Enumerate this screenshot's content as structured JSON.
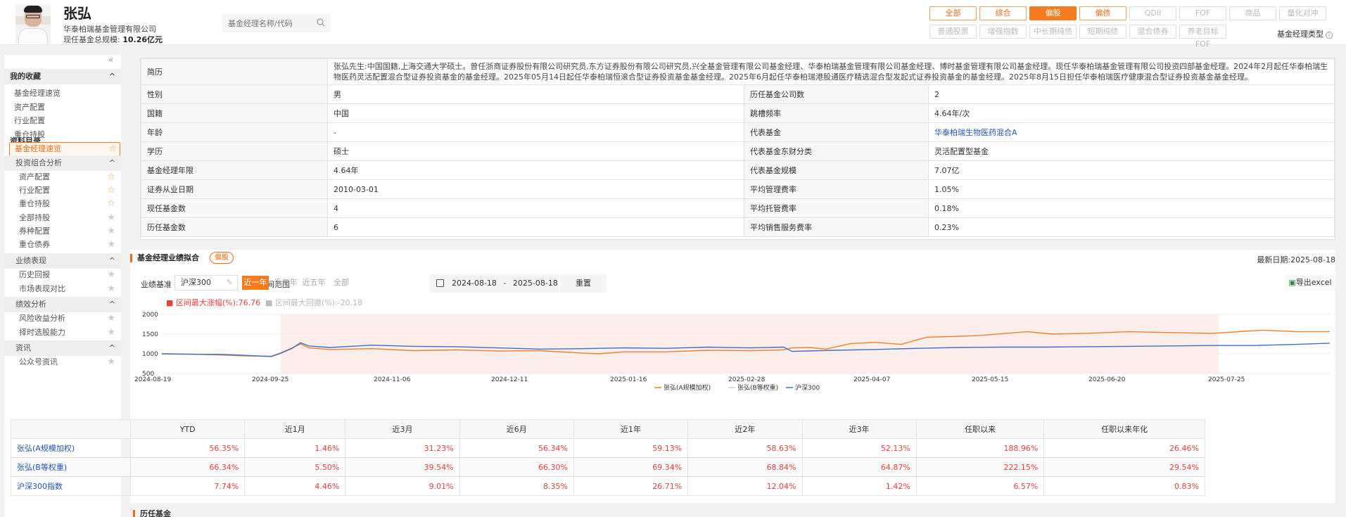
{
  "header": {
    "name": "张弘",
    "company": "华泰柏瑞基金管理有限公司",
    "scale_label": "现任基金总规模:",
    "scale_value": "10.26亿元",
    "search_placeholder": "基金经理名称/代码",
    "type_label": "基金经理类型",
    "type_buttons_row1": [
      "全部",
      "综合",
      "偏股",
      "偏债",
      "QDII",
      "FOF",
      "商品",
      "量化对冲"
    ],
    "type_buttons_row2": [
      "普通股票",
      "增强指数",
      "中长期纯债",
      "短期纯债",
      "混合债券",
      "养老目标FOF"
    ],
    "active_type": "偏股"
  },
  "sidebar": {
    "favorites_title": "我的收藏",
    "favorites": [
      "基金经理速览",
      "资产配置",
      "行业配置",
      "重仓持股"
    ],
    "catalog_title": "资料目录",
    "selected_item": "基金经理速览",
    "portfolio_title": "投资组合分析",
    "portfolio_items": [
      {
        "label": "资产配置",
        "starred": true
      },
      {
        "label": "行业配置",
        "starred": true
      },
      {
        "label": "重仓持股",
        "starred": true
      },
      {
        "label": "全部持股",
        "starred": false
      },
      {
        "label": "券种配置",
        "starred": false
      },
      {
        "label": "重仓债券",
        "starred": false
      }
    ],
    "performance_title": "业绩表现",
    "performance_items": [
      "历史回报",
      "市场表现对比"
    ],
    "attribution_title": "绩效分析",
    "attribution_items": [
      "风险收益分析",
      "择时选股能力"
    ],
    "news_title": "资讯",
    "news_items": [
      "公众号资讯"
    ]
  },
  "profile": {
    "bio_label": "简历",
    "bio": "张弘先生:中国国籍,上海交通大学硕士。曾任浙商证券股份有限公司研究员,东方证券股份有限公司研究员,兴全基金管理有限公司基金经理、华泰柏瑞基金管理有限公司基金经理、博时基金管理有限公司基金经理。现任华泰柏瑞基金管理有限公司投资四部基金经理。2024年2月起任华泰柏瑞生物医药灵活配置混合型证券投资基金的基金经理。2025年05月14日起任华泰柏瑞恒滚合型证券投资基金基金经理。2025年6月起任华泰柏瑞港股通医疗精选混合型发起式证券投资基金的基金经理。2025年8月15日担任华泰柏瑞医疗健康混合型证券投资基金基金经理。",
    "rows": [
      {
        "l1": "性别",
        "v1": "男",
        "l2": "历任基金公司数",
        "v2": "2"
      },
      {
        "l1": "国籍",
        "v1": "中国",
        "l2": "跳槽频率",
        "v2": "4.64年/次"
      },
      {
        "l1": "年龄",
        "v1": "-",
        "l2": "代表基金",
        "v2": "华泰柏瑞生物医药混合A"
      },
      {
        "l1": "学历",
        "v1": "硕士",
        "l2": "代表基金东财分类",
        "v2": "灵活配置型基金"
      },
      {
        "l1": "基金经理年限",
        "v1": "4.64年",
        "l2": "代表基金规模",
        "v2": "7.07亿"
      },
      {
        "l1": "证券从业日期",
        "v1": "2010-03-01",
        "l2": "平均管理费率",
        "v2": "1.05%"
      },
      {
        "l1": "现任基金数",
        "v1": "4",
        "l2": "平均托管费率",
        "v2": "0.18%"
      },
      {
        "l1": "历任基金数",
        "v1": "6",
        "l2": "平均销售服务费率",
        "v2": "0.23%"
      }
    ]
  },
  "performance": {
    "title": "基金经理业绩拟合",
    "tag": "偏股",
    "latest_date": "最新日期:2025-08-18",
    "bench_label": "业绩基准",
    "bench_value": "沪深300",
    "range_label": "时间范围",
    "ranges": [
      "近一年",
      "近三年",
      "近五年",
      "全部"
    ],
    "active_range": "近一年",
    "date_start": "2024-08-18",
    "date_sep": "-",
    "date_end": "2025-08-18",
    "reset": "重置",
    "export": "导出excel",
    "stat_max_rise": "■ 区间最大涨幅(%):76.76",
    "stat_max_drawdown": "■ 区间最大回撤(%):-20.18"
  },
  "chart_data": {
    "type": "line",
    "y_ticks": [
      "2000",
      "1500",
      "1000",
      "500"
    ],
    "ylim": [
      500,
      2000
    ],
    "x_ticks": [
      "2024-08-19",
      "2024-09-25",
      "2024-11-06",
      "2024-12-11",
      "2025-01-16",
      "2025-02-28",
      "2025-04-07",
      "2025-05-15",
      "2025-06-20",
      "2025-07-25"
    ],
    "highlight_range": [
      "2024-09-24",
      "2025-08-01"
    ],
    "series": [
      {
        "name": "张弘(A规模加权)",
        "color": "#f07f2a",
        "points": [
          [
            0,
            1000
          ],
          [
            0.03,
            995
          ],
          [
            0.07,
            970
          ],
          [
            0.1,
            945
          ],
          [
            0.13,
            940
          ],
          [
            0.14,
            1010
          ],
          [
            0.155,
            1150
          ],
          [
            0.165,
            1250
          ],
          [
            0.175,
            1150
          ],
          [
            0.2,
            1110
          ],
          [
            0.25,
            1130
          ],
          [
            0.3,
            1080
          ],
          [
            0.35,
            1100
          ],
          [
            0.4,
            1070
          ],
          [
            0.45,
            1080
          ],
          [
            0.5,
            1020
          ],
          [
            0.52,
            1000
          ],
          [
            0.55,
            1050
          ],
          [
            0.6,
            1050
          ],
          [
            0.65,
            1090
          ],
          [
            0.7,
            1080
          ],
          [
            0.74,
            1100
          ],
          [
            0.75,
            1150
          ],
          [
            0.77,
            1160
          ],
          [
            0.79,
            1120
          ],
          [
            0.82,
            1260
          ],
          [
            0.85,
            1290
          ],
          [
            0.88,
            1240
          ],
          [
            0.91,
            1420
          ],
          [
            0.94,
            1440
          ],
          [
            0.97,
            1460
          ],
          [
            1,
            1510
          ],
          [
            1.03,
            1560
          ],
          [
            1.06,
            1500
          ],
          [
            1.1,
            1520
          ],
          [
            1.15,
            1560
          ],
          [
            1.2,
            1540
          ],
          [
            1.25,
            1520
          ],
          [
            1.31,
            1600
          ],
          [
            1.35,
            1560
          ],
          [
            1.39,
            1560
          ]
        ]
      },
      {
        "name": "沪深300",
        "color": "#3d6fd1",
        "points": [
          [
            0,
            1000
          ],
          [
            0.03,
            990
          ],
          [
            0.07,
            985
          ],
          [
            0.1,
            960
          ],
          [
            0.13,
            930
          ],
          [
            0.14,
            1000
          ],
          [
            0.155,
            1140
          ],
          [
            0.165,
            1280
          ],
          [
            0.175,
            1200
          ],
          [
            0.2,
            1160
          ],
          [
            0.25,
            1220
          ],
          [
            0.3,
            1190
          ],
          [
            0.35,
            1180
          ],
          [
            0.4,
            1150
          ],
          [
            0.45,
            1120
          ],
          [
            0.5,
            1130
          ],
          [
            0.55,
            1150
          ],
          [
            0.6,
            1140
          ],
          [
            0.65,
            1170
          ],
          [
            0.7,
            1150
          ],
          [
            0.74,
            1170
          ],
          [
            0.75,
            1060
          ],
          [
            0.8,
            1090
          ],
          [
            0.85,
            1110
          ],
          [
            0.9,
            1140
          ],
          [
            0.95,
            1160
          ],
          [
            1,
            1170
          ],
          [
            1.05,
            1170
          ],
          [
            1.1,
            1180
          ],
          [
            1.15,
            1190
          ],
          [
            1.2,
            1200
          ],
          [
            1.25,
            1210
          ],
          [
            1.3,
            1210
          ],
          [
            1.35,
            1240
          ],
          [
            1.39,
            1270
          ]
        ]
      }
    ],
    "legend": [
      "张弘(A规模加权)",
      "张弘(B等权重)",
      "沪深300"
    ]
  },
  "returns": {
    "headers": [
      "",
      "YTD",
      "近1月",
      "近3月",
      "近6月",
      "近1年",
      "近2年",
      "近3年",
      "任职以来",
      "任职以来年化"
    ],
    "rows": [
      {
        "name": "张弘(A规模加权)",
        "values": [
          "56.35%",
          "1.46%",
          "31.23%",
          "56.34%",
          "59.13%",
          "58.63%",
          "52.13%",
          "188.96%",
          "26.46%"
        ]
      },
      {
        "name": "张弘(B等权重)",
        "values": [
          "66.34%",
          "5.50%",
          "39.54%",
          "66.30%",
          "69.34%",
          "68.84%",
          "64.87%",
          "222.15%",
          "29.54%"
        ]
      },
      {
        "name": "沪深300指数",
        "values": [
          "7.74%",
          "4.46%",
          "9.01%",
          "8.35%",
          "26.71%",
          "12.04%",
          "1.42%",
          "6.57%",
          "0.83%"
        ]
      }
    ]
  },
  "next_section": "历任基金"
}
